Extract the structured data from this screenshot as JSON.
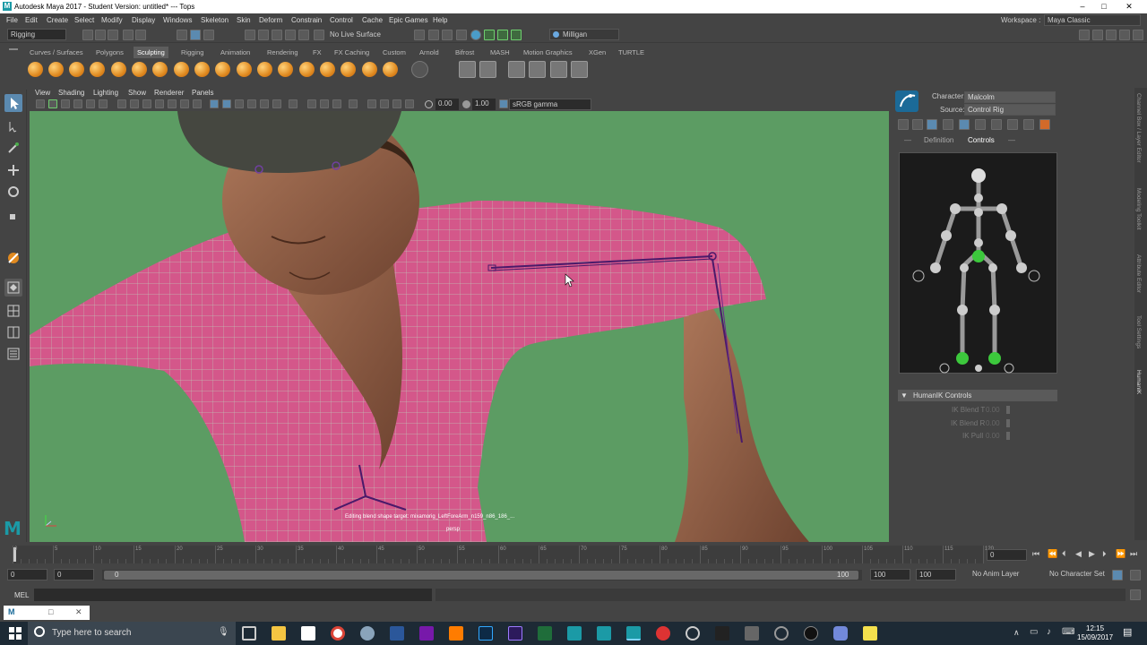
{
  "window": {
    "title": "Autodesk Maya 2017 - Student Version: untitled*   ---   Tops",
    "workspace_label": "Workspace :",
    "workspace_value": "Maya Classic"
  },
  "menus": [
    "File",
    "Edit",
    "Create",
    "Select",
    "Modify",
    "Display",
    "Windows",
    "Skeleton",
    "Skin",
    "Deform",
    "Constrain",
    "Control",
    "Cache",
    "Epic Games",
    "Help"
  ],
  "status_line": {
    "mode": "Rigging",
    "live_surface": "No Live Surface",
    "user": "Milligan"
  },
  "shelf_tabs": [
    "Curves / Surfaces",
    "Polygons",
    "Sculpting",
    "Rigging",
    "Animation",
    "Rendering",
    "FX",
    "FX Caching",
    "Custom",
    "Arnold",
    "Bifrost",
    "MASH",
    "Motion Graphics",
    "XGen",
    "TURTLE"
  ],
  "active_shelf_tab": "Sculpting",
  "viewport": {
    "menus": [
      "View",
      "Shading",
      "Lighting",
      "Show",
      "Renderer",
      "Panels"
    ],
    "exposure": "0.00",
    "gamma": "1.00",
    "color_space": "sRGB gamma",
    "hud_message": "Editing blend shape target: mixamorig_LeftForeArm_n159_n86_186_...",
    "camera": "persp"
  },
  "humanik": {
    "character_label": "Character:",
    "character_value": "Malcolm",
    "source_label": "Source:",
    "source_value": "Control Rig",
    "tabs": [
      "Definition",
      "Controls"
    ],
    "active_tab": "Controls",
    "section_title": "HumanIK Controls",
    "params": [
      {
        "label": "IK Blend T",
        "value": "0.00"
      },
      {
        "label": "IK Blend R",
        "value": "0.00"
      },
      {
        "label": "IK Pull",
        "value": "0.00"
      }
    ]
  },
  "side_tabs": [
    "Channel Box / Layer Editor",
    "Modeling Toolkit",
    "Attribute Editor",
    "Tool Settings",
    "HumanIK"
  ],
  "time_slider": {
    "ticks": [
      "0",
      "5",
      "10",
      "15",
      "20",
      "25",
      "30",
      "35",
      "40",
      "45",
      "50",
      "55",
      "60",
      "65",
      "70",
      "75",
      "80",
      "85",
      "90",
      "95",
      "100",
      "105",
      "110",
      "115",
      "120"
    ],
    "current_frame": "0"
  },
  "range_slider": {
    "start": "0",
    "inner_start": "0",
    "slider_start": "0",
    "slider_end": "100",
    "inner_end": "100",
    "end": "100",
    "anim_layer": "No Anim Layer",
    "character_set": "No Character Set"
  },
  "command_line": {
    "label": "MEL"
  },
  "taskbar": {
    "search_placeholder": "Type here to search",
    "time": "12:15",
    "date": "15/09/2017"
  },
  "colors": {
    "viewport_bg": "#5c9c63",
    "shirt": "#d4578a",
    "wire": "#b8f0c8",
    "accent": "#1b9aa6"
  }
}
